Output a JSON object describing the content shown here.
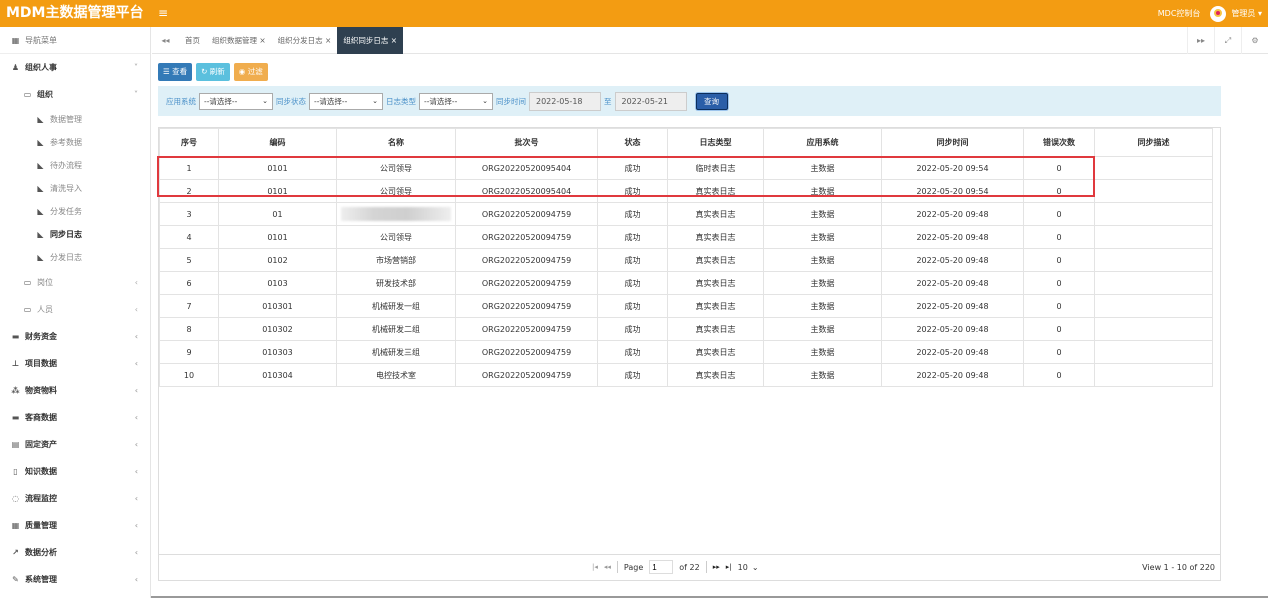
{
  "app": {
    "brand": "MDM主数据管理平台",
    "menu_icon": "≡",
    "control_link": "MDC控制台",
    "user_label": "管理员 ▾"
  },
  "sidebar": {
    "header": "导航菜单",
    "items": [
      {
        "label": "组织人事",
        "arrow": "˅"
      },
      {
        "label": "组织",
        "arrow": "˅"
      },
      {
        "label": "数据管理"
      },
      {
        "label": "参考数据"
      },
      {
        "label": "待办流程"
      },
      {
        "label": "清洗导入"
      },
      {
        "label": "分发任务"
      },
      {
        "label": "同步日志"
      },
      {
        "label": "分发日志"
      },
      {
        "label": "岗位",
        "arrow": "‹"
      },
      {
        "label": "人员",
        "arrow": "‹"
      },
      {
        "label": "财务资金",
        "arrow": "‹"
      },
      {
        "label": "项目数据",
        "arrow": "‹"
      },
      {
        "label": "物资物料",
        "arrow": "‹"
      },
      {
        "label": "客商数据",
        "arrow": "‹"
      },
      {
        "label": "固定资产",
        "arrow": "‹"
      },
      {
        "label": "知识数据",
        "arrow": "‹"
      },
      {
        "label": "流程监控",
        "arrow": "‹"
      },
      {
        "label": "质量管理",
        "arrow": "‹"
      },
      {
        "label": "数据分析",
        "arrow": "‹"
      },
      {
        "label": "系统管理",
        "arrow": "‹"
      }
    ]
  },
  "tabs": {
    "nav_left": "◂◂",
    "nav_right": "▸▸",
    "items": [
      {
        "label": "首页"
      },
      {
        "label": "组织数据管理 ×"
      },
      {
        "label": "组织分发日志 ×"
      },
      {
        "label": "组织同步日志 ×"
      }
    ]
  },
  "toolbar": {
    "view_label": "☰ 查看",
    "refresh_label": "↻ 刷新",
    "filter_label": "◉ 过滤"
  },
  "filter": {
    "app_system_label": "应用系统",
    "sync_status_label": "同步状态",
    "log_type_label": "日志类型",
    "sync_time_label": "同步时间",
    "to_label": "至",
    "select_placeholder": "--请选择--",
    "date_from": "2022-05-18",
    "date_to": "2022-05-21",
    "query_label": "查询"
  },
  "table": {
    "columns": [
      "序号",
      "编码",
      "名称",
      "批次号",
      "状态",
      "日志类型",
      "应用系统",
      "同步时间",
      "错误次数",
      "同步描述"
    ],
    "rows": [
      [
        "1",
        "0101",
        "公司领导",
        "ORG20220520095404",
        "成功",
        "临时表日志",
        "主数据",
        "2022-05-20 09:54",
        "0",
        ""
      ],
      [
        "2",
        "0101",
        "公司领导",
        "ORG20220520095404",
        "成功",
        "真实表日志",
        "主数据",
        "2022-05-20 09:54",
        "0",
        ""
      ],
      [
        "3",
        "01",
        "",
        "ORG20220520094759",
        "成功",
        "真实表日志",
        "主数据",
        "2022-05-20 09:48",
        "0",
        ""
      ],
      [
        "4",
        "0101",
        "公司领导",
        "ORG20220520094759",
        "成功",
        "真实表日志",
        "主数据",
        "2022-05-20 09:48",
        "0",
        ""
      ],
      [
        "5",
        "0102",
        "市场营销部",
        "ORG20220520094759",
        "成功",
        "真实表日志",
        "主数据",
        "2022-05-20 09:48",
        "0",
        ""
      ],
      [
        "6",
        "0103",
        "研发技术部",
        "ORG20220520094759",
        "成功",
        "真实表日志",
        "主数据",
        "2022-05-20 09:48",
        "0",
        ""
      ],
      [
        "7",
        "010301",
        "机械研发一组",
        "ORG20220520094759",
        "成功",
        "真实表日志",
        "主数据",
        "2022-05-20 09:48",
        "0",
        ""
      ],
      [
        "8",
        "010302",
        "机械研发二组",
        "ORG20220520094759",
        "成功",
        "真实表日志",
        "主数据",
        "2022-05-20 09:48",
        "0",
        ""
      ],
      [
        "9",
        "010303",
        "机械研发三组",
        "ORG20220520094759",
        "成功",
        "真实表日志",
        "主数据",
        "2022-05-20 09:48",
        "0",
        ""
      ],
      [
        "10",
        "010304",
        "电控技术室",
        "ORG20220520094759",
        "成功",
        "真实表日志",
        "主数据",
        "2022-05-20 09:48",
        "0",
        ""
      ]
    ]
  },
  "pager": {
    "page_label": "Page",
    "page_value": "1",
    "of_label": "of 22",
    "page_size": "10",
    "summary": "View 1 - 10 of 220"
  }
}
